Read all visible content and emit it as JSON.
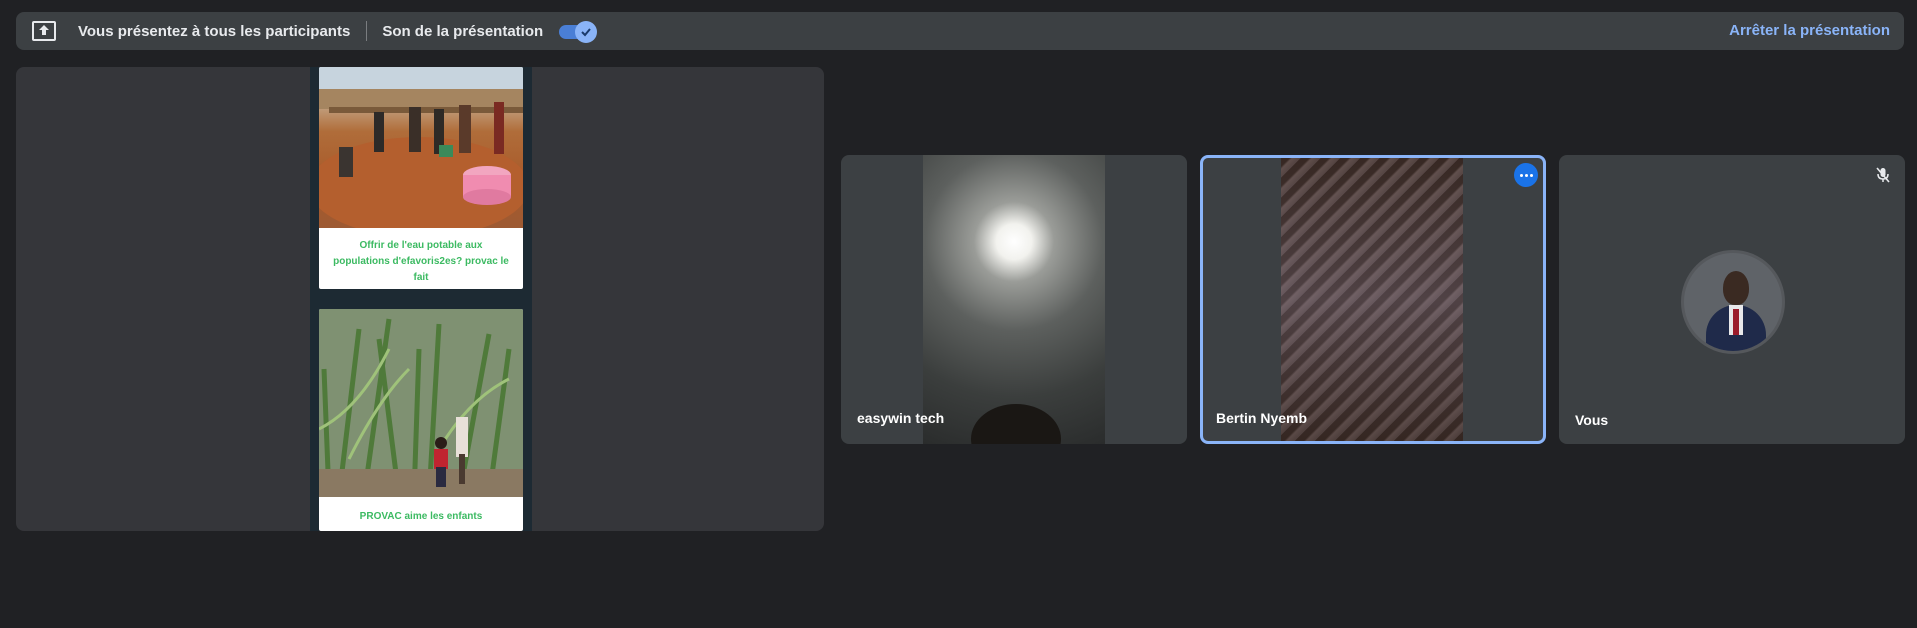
{
  "topbar": {
    "presenting_text": "Vous présentez à tous les participants",
    "sound_label": "Son de la présentation",
    "sound_enabled": true,
    "stop_label": "Arrêter la présentation",
    "present_icon": "present-to-all-icon",
    "accent_color": "#8ab4f8"
  },
  "presentation": {
    "cards": [
      {
        "caption": "Offrir de l'eau potable aux populations d'efavoris2es? provac le fait"
      },
      {
        "caption": "PROVAC aime les enfants"
      }
    ],
    "caption_color": "#3cba62"
  },
  "participants": [
    {
      "name": "easywin tech",
      "highlighted": false
    },
    {
      "name": "Bertin Nyemb",
      "highlighted": true,
      "more_icon": "more-horiz-icon"
    },
    {
      "name": "Vous",
      "highlighted": false,
      "mic_icon": "mic-off-icon"
    }
  ],
  "colors": {
    "background": "#202124",
    "tile": "#3c4043",
    "highlight_border": "#8ab4f8"
  }
}
